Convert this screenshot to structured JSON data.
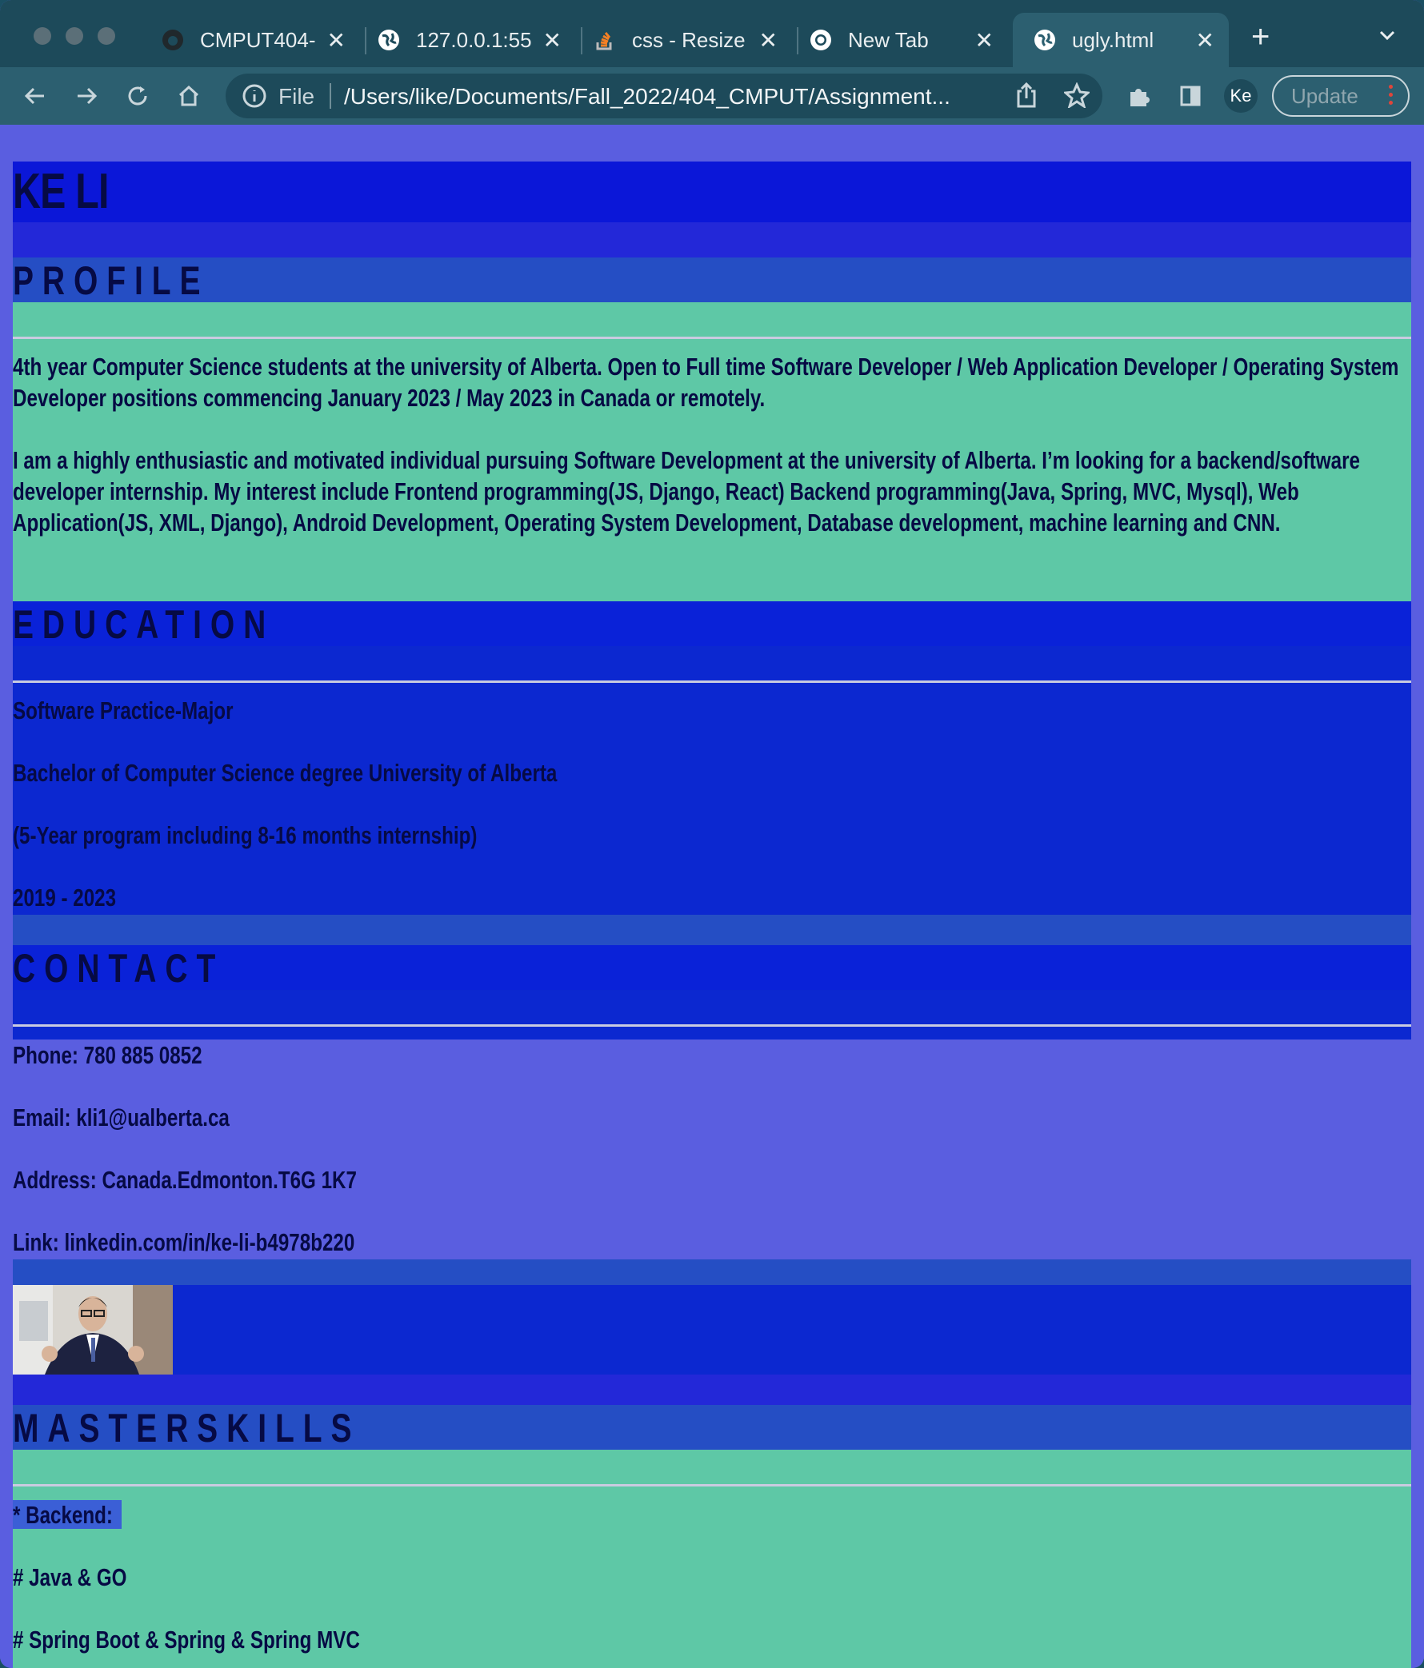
{
  "browser": {
    "tabs": [
      {
        "title": "CMPUT404-",
        "icon": "github-icon"
      },
      {
        "title": "127.0.0.1:55",
        "icon": "globe-icon"
      },
      {
        "title": "css - Resize",
        "icon": "stackoverflow-icon"
      },
      {
        "title": "New Tab",
        "icon": "chrome-icon"
      },
      {
        "title": "ugly.html",
        "icon": "globe-icon",
        "active": true
      }
    ],
    "address": {
      "scheme": "File",
      "url": "/Users/like/Documents/Fall_2022/404_CMPUT/Assignment..."
    },
    "profile_initials": "Ke",
    "update_label": "Update"
  },
  "resume": {
    "name": "KE LI",
    "profile": {
      "heading": "PROFILE",
      "paragraph1": "4th year Computer Science students at the university of Alberta. Open to Full time Software Developer / Web Application Developer / Operating System Developer positions commencing January 2023 / May 2023 in Canada or remotely.",
      "paragraph2": "I am a highly enthusiastic and motivated individual pursuing Software Development at the university of Alberta. I’m looking for a backend/software developer internship. My interest include Frontend programming(JS, Django, React) Backend programming(Java, Spring, MVC, Mysql), Web Application(JS, XML, Django), Android Development, Operating System Development, Database development, machine learning and CNN."
    },
    "education": {
      "heading": "EDUCATION",
      "lines": [
        "Software Practice-Major",
        "Bachelor of Computer Science degree University of Alberta",
        "(5-Year program including 8-16 months internship)",
        "2019 - 2023"
      ]
    },
    "contact": {
      "heading": "CONTACT",
      "phone": "Phone: 780 885 0852",
      "email": "Email: kli1@ualberta.ca",
      "address": "Address: Canada.Edmonton.T6G 1K7",
      "link": "Link: linkedin.com/in/ke-li-b4978b220"
    },
    "skills": {
      "heading": "MASTERSKILLS",
      "lines": [
        "* Backend:",
        "# Java & GO",
        "# Spring Boot & Spring & Spring MVC"
      ]
    }
  },
  "colors": {
    "page_bg": "#5a5ee0",
    "name_bg": "#0b17d8",
    "heading_bg": "#254ec4",
    "profile_bg": "#5ec8a6",
    "edu_bg": "#0c28d0",
    "contact_bg": "#0c28d0",
    "text": "#060a44"
  }
}
